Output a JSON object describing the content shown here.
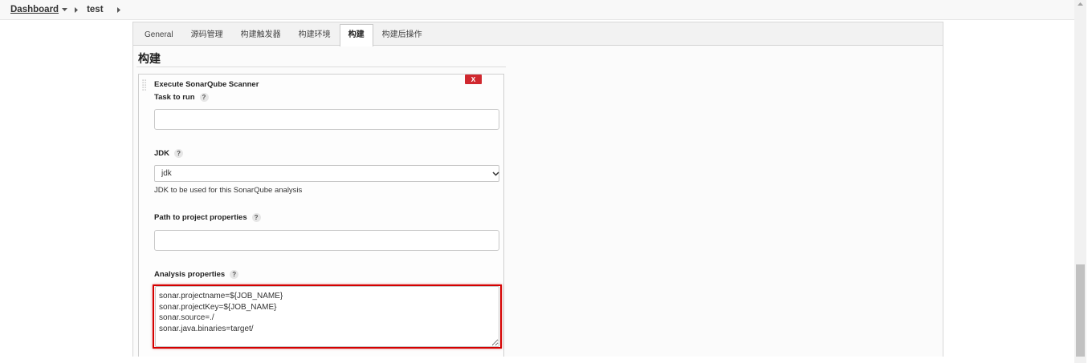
{
  "breadcrumb": {
    "items": [
      {
        "label": "Dashboard"
      },
      {
        "label": "test"
      }
    ]
  },
  "tabs": [
    {
      "label": "General",
      "active": false
    },
    {
      "label": "源码管理",
      "active": false
    },
    {
      "label": "构建触发器",
      "active": false
    },
    {
      "label": "构建环境",
      "active": false
    },
    {
      "label": "构建",
      "active": true
    },
    {
      "label": "构建后操作",
      "active": false
    }
  ],
  "section": {
    "title": "构建"
  },
  "build_step": {
    "title": "Execute SonarQube Scanner",
    "delete_label": "X",
    "task_to_run": {
      "label": "Task to run",
      "help": "?",
      "value": ""
    },
    "jdk": {
      "label": "JDK",
      "help": "?",
      "selected": "jdk",
      "description": "JDK to be used for this SonarQube analysis"
    },
    "project_properties": {
      "label": "Path to project properties",
      "help": "?",
      "value": ""
    },
    "analysis_properties": {
      "label": "Analysis properties",
      "help": "?",
      "value": "sonar.projectname=${JOB_NAME}\nsonar.projectKey=${JOB_NAME}\nsonar.source=./\nsonar.java.binaries=target/"
    }
  },
  "colors": {
    "delete_button": "#d0282f",
    "highlight": "#d40000"
  },
  "icons": {
    "breadcrumb_dropdown": "chevron-down-icon",
    "breadcrumb_separator": "chevron-right-icon",
    "help": "help-icon",
    "drag_handle": "drag-handle-icon",
    "select_arrow": "chevron-down-icon",
    "scroll_up": "scroll-up-arrow-icon"
  }
}
